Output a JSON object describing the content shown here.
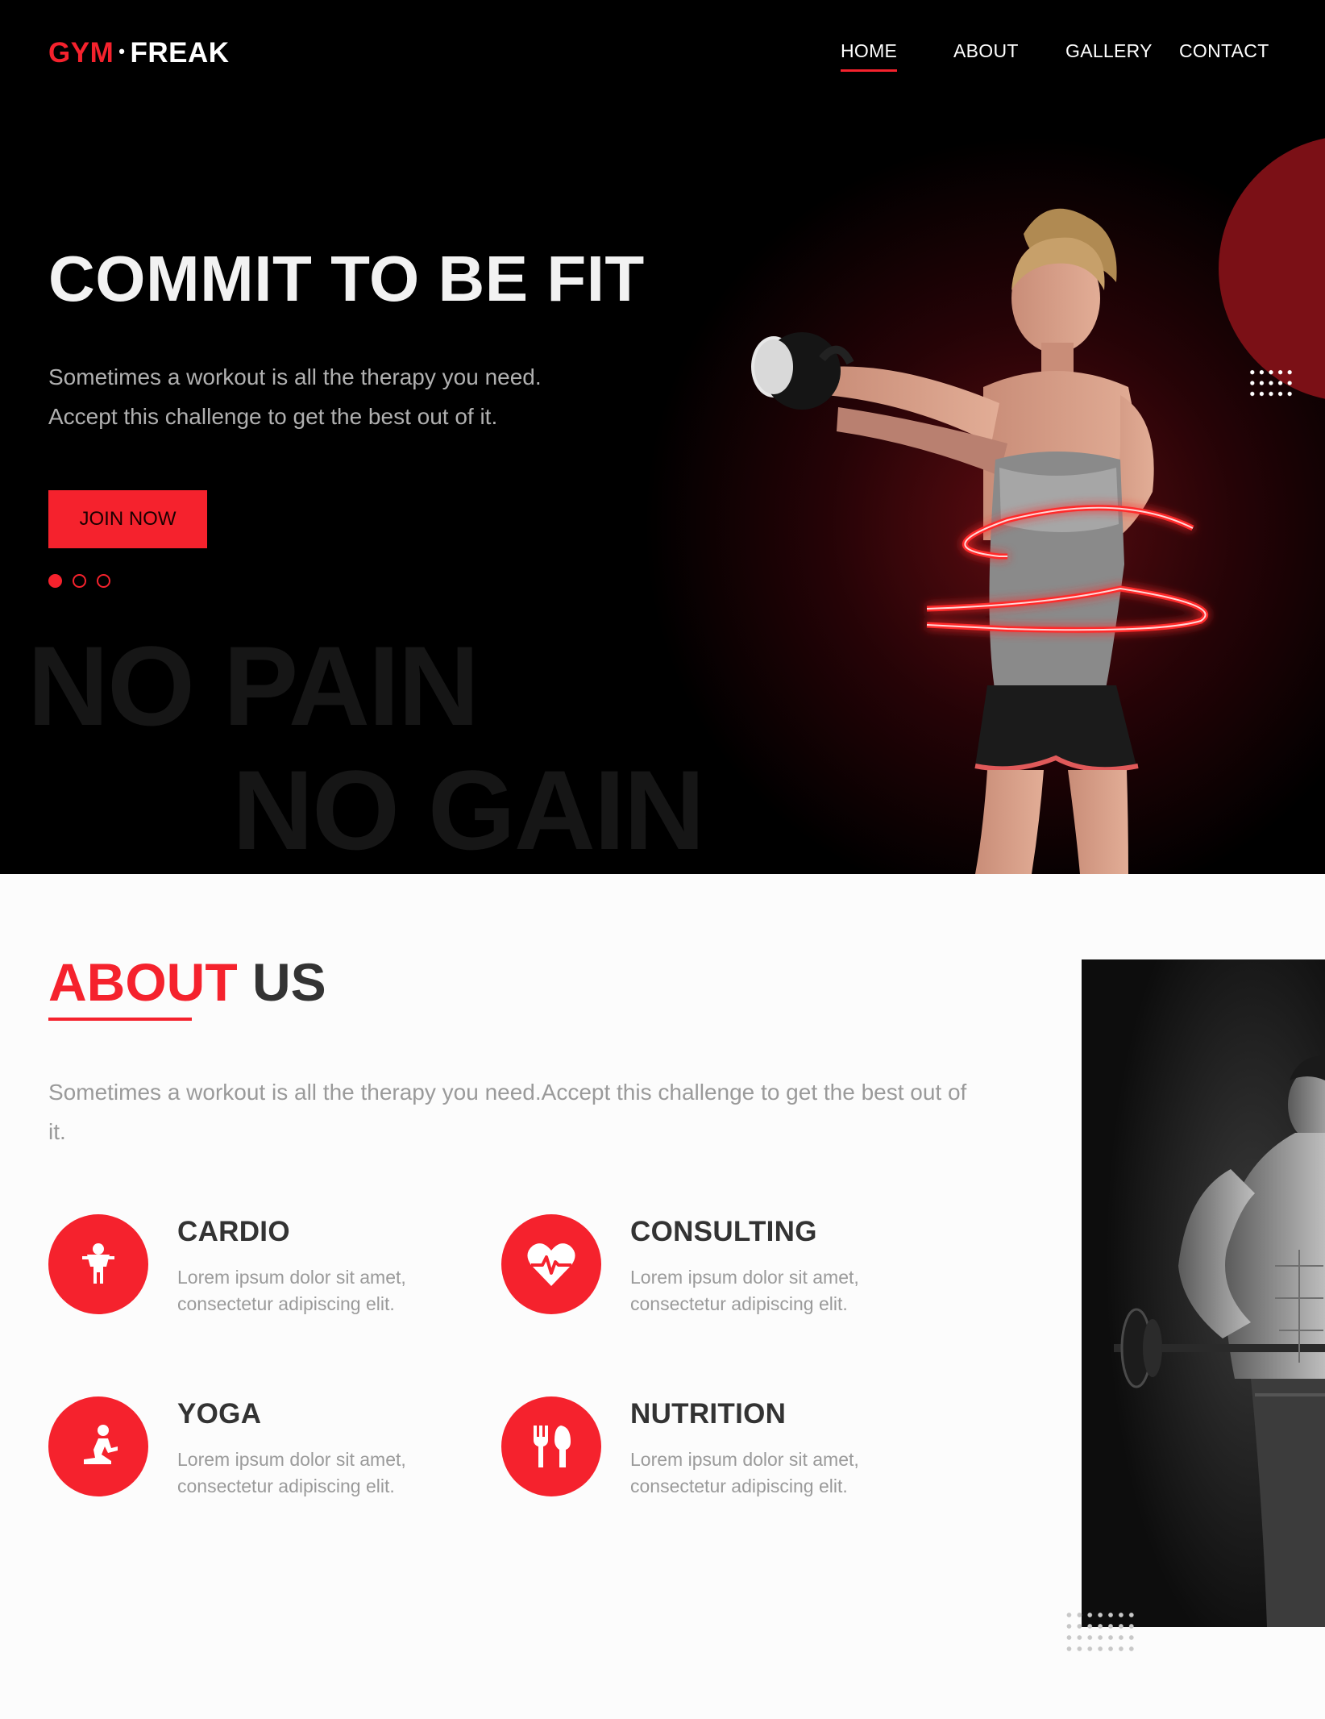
{
  "brand": {
    "part1": "GYM",
    "separator": "•",
    "part2": "FREAK"
  },
  "nav": {
    "items": [
      {
        "label": "HOME",
        "active": true
      },
      {
        "label": "ABOUT",
        "active": false
      },
      {
        "label": "GALLERY",
        "active": false
      },
      {
        "label": "CONTACT",
        "active": false
      }
    ]
  },
  "hero": {
    "title": "COMMIT TO BE FIT",
    "subtitle_line1": "Sometimes a workout is all the therapy you need.",
    "subtitle_line2": "Accept this challenge to get the best out of it.",
    "cta_label": "JOIN NOW",
    "slider": {
      "count": 3,
      "active_index": 0
    },
    "bg_word1": "NO PAIN",
    "bg_word2": "NO GAIN"
  },
  "about": {
    "title_red": "ABOUT",
    "title_dark": "US",
    "text": "Sometimes a workout is all the therapy you need.Accept this challenge to get the best out of it.",
    "services": [
      {
        "title": "CARDIO",
        "desc_line1": "Lorem ipsum dolor sit amet,",
        "desc_line2": "consectetur adipiscing elit.",
        "icon": "person-icon"
      },
      {
        "title": "CONSULTING",
        "desc_line1": "Lorem ipsum dolor sit amet,",
        "desc_line2": "consectetur adipiscing elit.",
        "icon": "heart-pulse-icon"
      },
      {
        "title": "YOGA",
        "desc_line1": "Lorem ipsum dolor sit amet,",
        "desc_line2": "consectetur adipiscing elit.",
        "icon": "yoga-pose-icon"
      },
      {
        "title": "NUTRITION",
        "desc_line1": "Lorem ipsum dolor sit amet,",
        "desc_line2": "consectetur adipiscing elit.",
        "icon": "fork-spoon-icon"
      }
    ]
  },
  "colors": {
    "accent": "#f5222d",
    "hero_bg": "#000000",
    "heading_dark": "#333333",
    "muted_text": "#9a9a9a"
  }
}
